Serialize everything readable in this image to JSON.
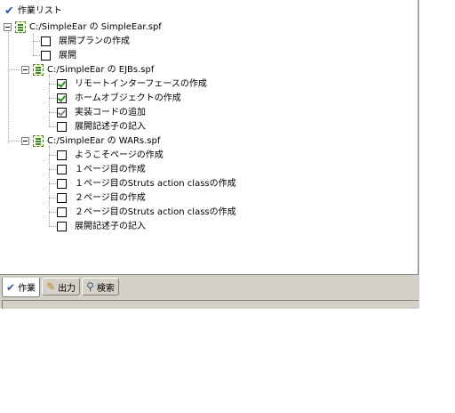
{
  "panel": {
    "title": "作業リスト",
    "title_icon": "checkmark-icon"
  },
  "tree": {
    "projects": [
      {
        "label": "C:/SimpleEar の SimpleEar.spf",
        "tasks": [
          {
            "label": "展開プランの作成",
            "checked": false
          },
          {
            "label": "展開",
            "checked": false
          }
        ]
      },
      {
        "label": "C:/SimpleEar の EJBs.spf",
        "tasks": [
          {
            "label": "リモートインターフェースの作成",
            "checked": true
          },
          {
            "label": "ホームオブジェクトの作成",
            "checked": true
          },
          {
            "label": "実装コードの追加",
            "checked": "gray"
          },
          {
            "label": "展開記述子の記入",
            "checked": false
          }
        ]
      },
      {
        "label": "C:/SimpleEar の WARs.spf",
        "tasks": [
          {
            "label": "ようこそページの作成",
            "checked": false
          },
          {
            "label": "１ページ目の作成",
            "checked": false
          },
          {
            "label": "１ページ目のStruts action classの作成",
            "checked": false
          },
          {
            "label": "２ページ目の作成",
            "checked": false
          },
          {
            "label": "２ページ目のStruts action classの作成",
            "checked": false
          },
          {
            "label": "展開記述子の記入",
            "checked": false
          }
        ]
      }
    ]
  },
  "tabs": [
    {
      "label": "作業",
      "icon": "checkmark-icon",
      "active": true
    },
    {
      "label": "出力",
      "icon": "pencil-icon",
      "active": false
    },
    {
      "label": "検索",
      "icon": "magnifier-icon",
      "active": false
    }
  ],
  "colors": {
    "check_green": "#1a9a1a",
    "panel_bg": "#d4d0c8"
  }
}
